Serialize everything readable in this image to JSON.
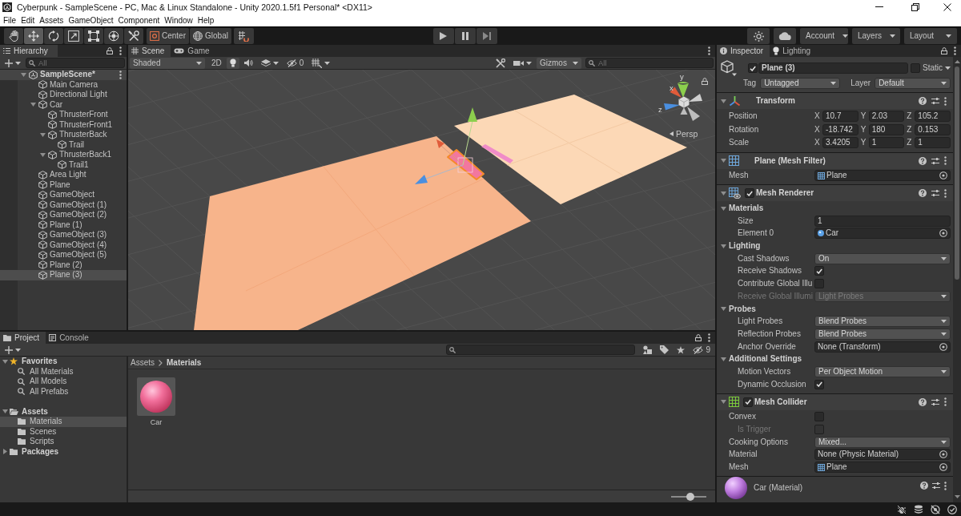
{
  "window": {
    "title": "Cyberpunk - SampleScene - PC, Mac & Linux Standalone - Unity 2020.1.5f1 Personal* <DX11>"
  },
  "menu": [
    "File",
    "Edit",
    "Assets",
    "GameObject",
    "Component",
    "Window",
    "Help"
  ],
  "toolbar": {
    "tools": [
      {
        "kind": "hand",
        "selected": false
      },
      {
        "kind": "move",
        "selected": true
      },
      {
        "kind": "rotate",
        "selected": false
      },
      {
        "kind": "scale",
        "selected": false
      },
      {
        "kind": "rect",
        "selected": false
      },
      {
        "kind": "transform",
        "selected": false
      },
      {
        "kind": "custom",
        "selected": false
      }
    ],
    "pivot_mode": "Center",
    "pivot_rotation": "Global",
    "playback": [
      {
        "kind": "play"
      },
      {
        "kind": "pause"
      },
      {
        "kind": "step"
      }
    ],
    "menus": [
      "Account",
      "Layers",
      "Layout"
    ]
  },
  "hierarchy": {
    "title": "Hierarchy",
    "search_placeholder": "All",
    "items": [
      {
        "label": "SampleScene*",
        "kind": "scene",
        "expanded": true,
        "selected": false,
        "children": [
          {
            "label": "Main Camera",
            "selected": false
          },
          {
            "label": "Directional Light",
            "selected": false
          },
          {
            "label": "Car",
            "expanded": true,
            "selected": false,
            "children": [
              {
                "label": "ThrusterFront",
                "selected": false
              },
              {
                "label": "ThrusterFront1",
                "selected": false
              },
              {
                "label": "ThrusterBack",
                "expanded": true,
                "selected": false,
                "children": [
                  {
                    "label": "Trail",
                    "selected": false
                  }
                ]
              },
              {
                "label": "ThrusterBack1",
                "expanded": true,
                "selected": false,
                "children": [
                  {
                    "label": "Trail1",
                    "selected": false
                  }
                ]
              }
            ]
          },
          {
            "label": "Area Light",
            "selected": false
          },
          {
            "label": "Plane",
            "selected": false
          },
          {
            "label": "GameObject",
            "selected": false
          },
          {
            "label": "GameObject (1)",
            "selected": false
          },
          {
            "label": "GameObject (2)",
            "selected": false
          },
          {
            "label": "Plane (1)",
            "selected": false
          },
          {
            "label": "GameObject (3)",
            "selected": false
          },
          {
            "label": "GameObject (4)",
            "selected": false
          },
          {
            "label": "GameObject (5)",
            "selected": false
          },
          {
            "label": "Plane (2)",
            "selected": false
          },
          {
            "label": "Plane (3)",
            "selected": true
          }
        ]
      }
    ]
  },
  "scene_view": {
    "tabs": [
      {
        "label": "Scene",
        "kind": "scene",
        "selected": true
      },
      {
        "label": "Game",
        "kind": "game",
        "selected": false
      }
    ],
    "draw_mode": "Shaded",
    "mode_2d": "2D",
    "hidden_count": "0",
    "gizmos": "Gizmos",
    "search_placeholder": "All",
    "axes": [
      "y",
      "x",
      "z"
    ],
    "projection": "Persp"
  },
  "inspector": {
    "tabs": [
      {
        "label": "Inspector",
        "kind": "info",
        "selected": true
      },
      {
        "label": "Lighting",
        "kind": "lighting",
        "selected": false
      }
    ],
    "object": {
      "name": "Plane (3)",
      "active": true,
      "static_label": "Static",
      "static": false,
      "tag_label": "Tag",
      "tag": "Untagged",
      "layer_label": "Layer",
      "layer": "Default"
    },
    "components": [
      {
        "kind": "transform",
        "title": "Transform",
        "expanded": true,
        "rows": [
          {
            "kind": "vector3",
            "label": "Position",
            "disabled": false,
            "values": [
              {
                "axis": "X",
                "value": "10.7"
              },
              {
                "axis": "Y",
                "value": "2.03"
              },
              {
                "axis": "Z",
                "value": "105.2"
              }
            ]
          },
          {
            "kind": "vector3",
            "label": "Rotation",
            "disabled": false,
            "values": [
              {
                "axis": "X",
                "value": "-18.742"
              },
              {
                "axis": "Y",
                "value": "180"
              },
              {
                "axis": "Z",
                "value": "0.153"
              }
            ]
          },
          {
            "kind": "vector3",
            "label": "Scale",
            "disabled": false,
            "values": [
              {
                "axis": "X",
                "value": "3.4205"
              },
              {
                "axis": "Y",
                "value": "1"
              },
              {
                "axis": "Z",
                "value": "1"
              }
            ]
          }
        ]
      },
      {
        "kind": "mesh_filter",
        "title": "Plane (Mesh Filter)",
        "expanded": true,
        "rows": [
          {
            "kind": "mesh",
            "label": "Mesh",
            "value": "Plane",
            "disabled": false
          }
        ]
      },
      {
        "kind": "mesh_renderer",
        "title": "Mesh Renderer",
        "enabled": true,
        "expanded": true,
        "rows": [
          {
            "kind": "section",
            "label": "Materials",
            "expanded": true,
            "children": [
              {
                "kind": "text",
                "label": "Size",
                "value": "1",
                "disabled": false
              },
              {
                "kind": "material",
                "label": "Element 0",
                "value": "Car",
                "disabled": false
              }
            ]
          },
          {
            "kind": "section",
            "label": "Lighting",
            "expanded": true,
            "children": [
              {
                "kind": "dropdown",
                "label": "Cast Shadows",
                "value": "On",
                "disabled": false
              },
              {
                "kind": "checkbox",
                "label": "Receive Shadows",
                "checked": true,
                "disabled": false
              },
              {
                "kind": "checkbox",
                "label": "Contribute Global Illu",
                "checked": false,
                "disabled": false
              },
              {
                "kind": "dropdown",
                "label": "Receive Global Illumi",
                "value": "Light Probes",
                "disabled": true
              }
            ]
          },
          {
            "kind": "section",
            "label": "Probes",
            "expanded": true,
            "children": [
              {
                "kind": "dropdown",
                "label": "Light Probes",
                "value": "Blend Probes",
                "disabled": false
              },
              {
                "kind": "dropdown",
                "label": "Reflection Probes",
                "value": "Blend Probes",
                "disabled": false
              },
              {
                "kind": "object",
                "label": "Anchor Override",
                "value": "None (Transform)",
                "disabled": false
              }
            ]
          },
          {
            "kind": "section",
            "label": "Additional Settings",
            "expanded": true,
            "children": [
              {
                "kind": "dropdown",
                "label": "Motion Vectors",
                "value": "Per Object Motion",
                "disabled": false
              },
              {
                "kind": "checkbox",
                "label": "Dynamic Occlusion",
                "checked": true,
                "disabled": false
              }
            ]
          }
        ]
      },
      {
        "kind": "mesh_collider",
        "title": "Mesh Collider",
        "enabled": true,
        "expanded": true,
        "rows": [
          {
            "kind": "checkbox",
            "label": "Convex",
            "checked": false,
            "disabled": false,
            "children": [
              {
                "kind": "checkbox",
                "label": "Is Trigger",
                "checked": false,
                "disabled": true
              }
            ]
          },
          {
            "kind": "dropdown",
            "label": "Cooking Options",
            "value": "Mixed...",
            "disabled": false
          },
          {
            "kind": "object",
            "label": "Material",
            "value": "None (Physic Material)",
            "disabled": false
          },
          {
            "kind": "mesh",
            "label": "Mesh",
            "value": "Plane",
            "disabled": false
          }
        ]
      },
      {
        "kind": "material",
        "title": "Car (Material)"
      }
    ]
  },
  "project": {
    "tabs": [
      {
        "label": "Project",
        "kind": "folder",
        "selected": true
      },
      {
        "label": "Console",
        "kind": "console",
        "selected": false
      }
    ],
    "hidden_count": "9",
    "tree": [
      {
        "label": "Favorites",
        "kind": "favorites",
        "expanded": true,
        "selected": false,
        "children": [
          {
            "label": "All Materials",
            "kind": "search",
            "selected": false
          },
          {
            "label": "All Models",
            "kind": "search",
            "selected": false
          },
          {
            "label": "All Prefabs",
            "kind": "search",
            "selected": false
          }
        ]
      },
      {
        "label": "Assets",
        "kind": "folder",
        "expanded": true,
        "selected": false,
        "children": [
          {
            "label": "Materials",
            "kind": "folder",
            "selected": true
          },
          {
            "label": "Scenes",
            "kind": "folder",
            "selected": false
          },
          {
            "label": "Scripts",
            "kind": "folder",
            "selected": false
          }
        ]
      },
      {
        "label": "Packages",
        "kind": "folder",
        "expanded": false,
        "selected": false
      }
    ],
    "breadcrumb": [
      "Assets",
      "Materials"
    ],
    "assets": [
      {
        "label": "Car",
        "kind": "material",
        "selected": false
      }
    ],
    "zoom": {
      "level": 0.55
    }
  }
}
